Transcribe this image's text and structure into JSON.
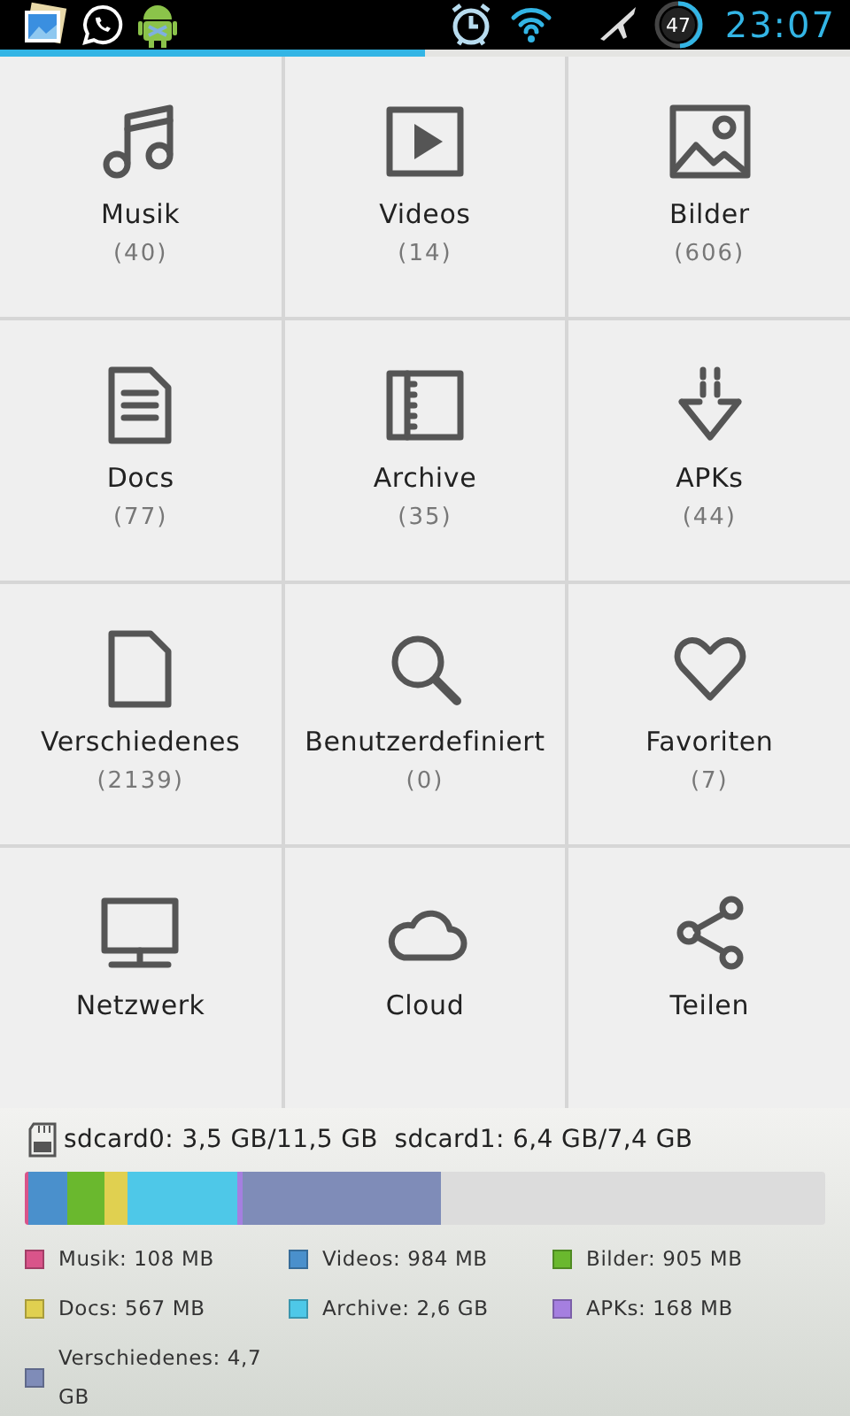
{
  "status_bar": {
    "battery": "47",
    "time": "23:07"
  },
  "progress": {
    "level": 0.5
  },
  "tiles": [
    {
      "kind": "music",
      "label": "Musik",
      "count": "(40)"
    },
    {
      "kind": "video",
      "label": "Videos",
      "count": "(14)"
    },
    {
      "kind": "image",
      "label": "Bilder",
      "count": "(606)"
    },
    {
      "kind": "doc",
      "label": "Docs",
      "count": "(77)"
    },
    {
      "kind": "archive",
      "label": "Archive",
      "count": "(35)"
    },
    {
      "kind": "apk",
      "label": "APKs",
      "count": "(44)"
    },
    {
      "kind": "file",
      "label": "Verschiedenes",
      "count": "(2139)"
    },
    {
      "kind": "search",
      "label": "Benutzerdefiniert",
      "count": "(0)"
    },
    {
      "kind": "heart",
      "label": "Favoriten",
      "count": "(7)"
    },
    {
      "kind": "network",
      "label": "Netzwerk"
    },
    {
      "kind": "cloud",
      "label": "Cloud"
    },
    {
      "kind": "share",
      "label": "Teilen"
    }
  ],
  "storage": {
    "summary": "sdcard0: 3,5 GB/11,5 GB  sdcard1: 6,4 GB/7,4 GB",
    "segments": [
      {
        "label": "Musik: 108 MB",
        "color": "#d9548a"
      },
      {
        "label": "Videos: 984 MB",
        "color": "#4a90cc"
      },
      {
        "label": "Bilder: 905 MB",
        "color": "#6ab82e"
      },
      {
        "label": "Docs: 567 MB",
        "color": "#e0d050"
      },
      {
        "label": "Archive: 2,6 GB",
        "color": "#4ec8e8"
      },
      {
        "label": "APKs: 168 MB",
        "color": "#a57fe0"
      },
      {
        "label": "Verschiedenes: 4,7 GB",
        "color": "#7f8cb8"
      }
    ]
  }
}
